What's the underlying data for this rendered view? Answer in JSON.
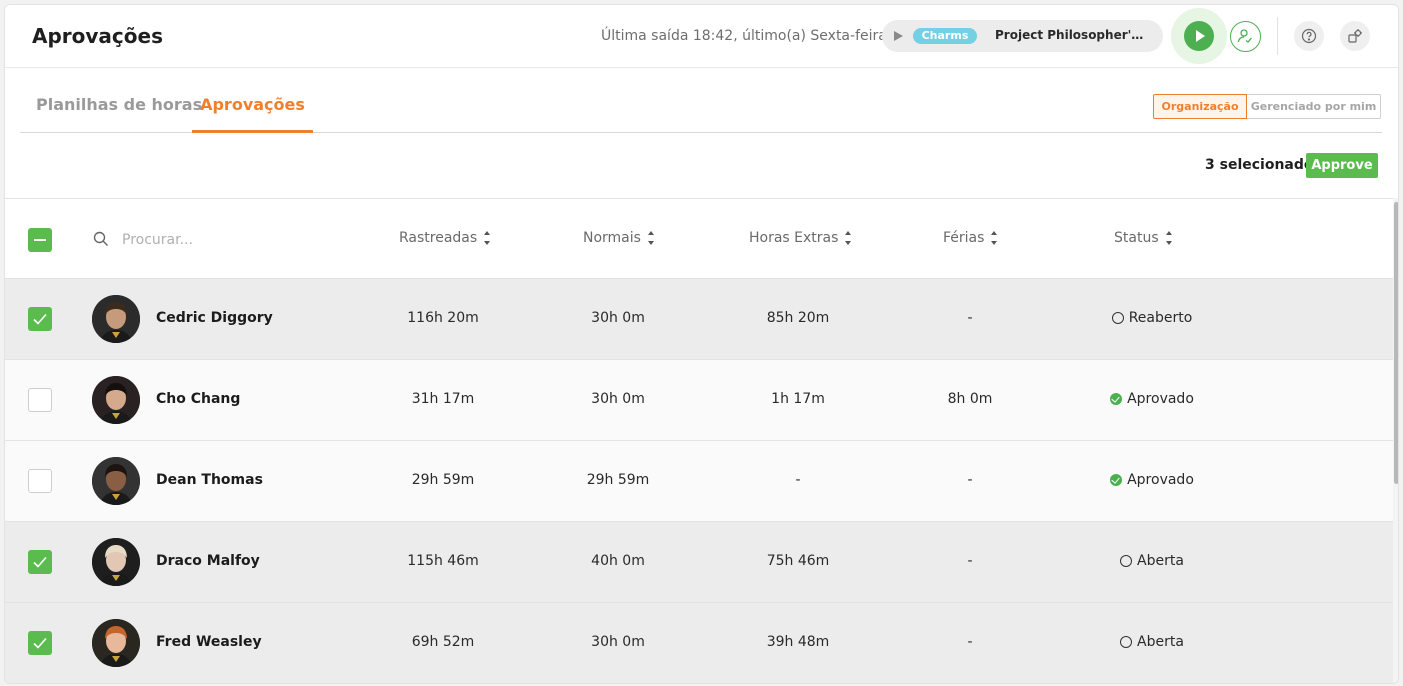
{
  "header": {
    "title": "Aprovações",
    "last_exit": "Última saída 18:42, último(a) Sexta-feira",
    "timer": {
      "tag": "Charms",
      "project": "Project Philosopher's St..."
    }
  },
  "tabs": [
    {
      "label": "Planilhas de horas",
      "active": false
    },
    {
      "label": "Aprovações",
      "active": true
    }
  ],
  "scope": {
    "organization": "Organização",
    "managed_by_me": "Gerenciado por mim"
  },
  "selection": {
    "count_label": "3 selecionado",
    "approve_label": "Approve"
  },
  "table": {
    "search_placeholder": "Procurar...",
    "columns": [
      "Rastreadas",
      "Normais",
      "Horas Extras",
      "Férias",
      "Status"
    ],
    "rows": [
      {
        "name": "Cedric Diggory",
        "tracked": "116h 20m",
        "normal": "30h 0m",
        "overtime": "85h 20m",
        "vacation": "-",
        "status": "Reaberto",
        "status_kind": "open",
        "selected": true
      },
      {
        "name": "Cho Chang",
        "tracked": "31h 17m",
        "normal": "30h 0m",
        "overtime": "1h 17m",
        "vacation": "8h 0m",
        "status": "Aprovado",
        "status_kind": "approved",
        "selected": false
      },
      {
        "name": "Dean Thomas",
        "tracked": "29h 59m",
        "normal": "29h 59m",
        "overtime": "-",
        "vacation": "-",
        "status": "Aprovado",
        "status_kind": "approved",
        "selected": false
      },
      {
        "name": "Draco Malfoy",
        "tracked": "115h 46m",
        "normal": "40h 0m",
        "overtime": "75h 46m",
        "vacation": "-",
        "status": "Aberta",
        "status_kind": "open",
        "selected": true
      },
      {
        "name": "Fred Weasley",
        "tracked": "69h 52m",
        "normal": "30h 0m",
        "overtime": "39h 48m",
        "vacation": "-",
        "status": "Aberta",
        "status_kind": "open",
        "selected": true
      }
    ]
  },
  "colors": {
    "accent": "#f07f2d",
    "success": "#5bbb4f",
    "tag": "#74d0e3"
  }
}
